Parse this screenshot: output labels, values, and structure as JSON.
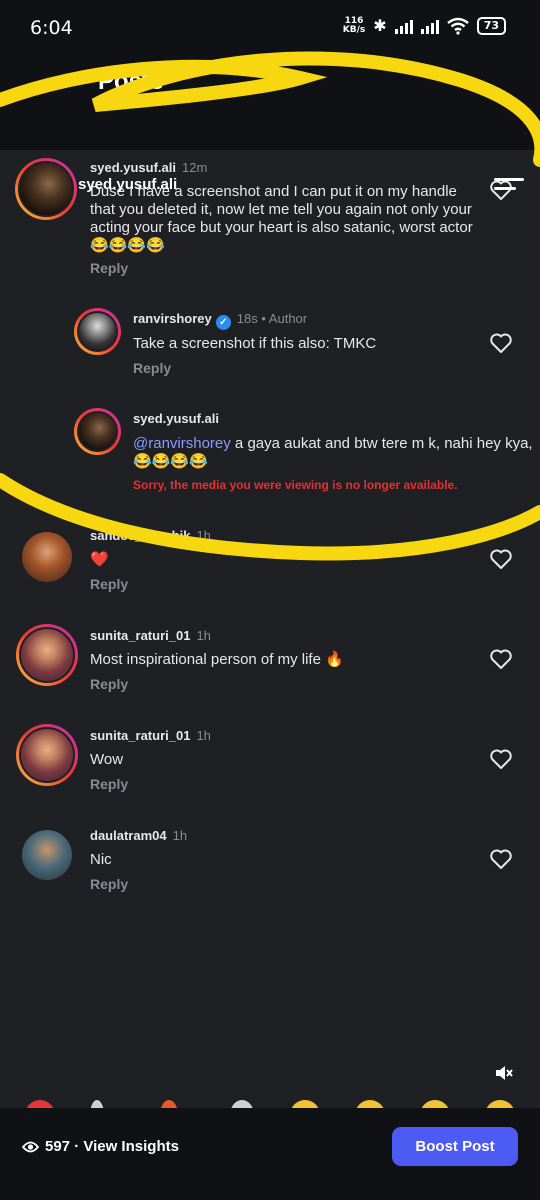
{
  "status_bar": {
    "time": "6:04",
    "speed_value": "116",
    "speed_unit": "KB/s",
    "battery": "73"
  },
  "header": {
    "title": "Posts"
  },
  "overlay": {
    "name": "syed.yusuf.ali"
  },
  "comments": [
    {
      "username": "syed.yusuf.ali",
      "time": "12m",
      "text": "Duse I have a screenshot and I can put it on my handle that you deleted it, now let me tell you again not only your acting your face but your heart is also satanic, worst actor 😂😂😂😂",
      "reply": "Reply"
    },
    {
      "username": "ranvirshorey",
      "time": "18s",
      "author": "• Author",
      "text": "Take a screenshot if this also: TMKC",
      "reply": "Reply"
    },
    {
      "username": "syed.yusuf.ali",
      "mention": "@ranvirshorey",
      "text": " a gaya aukat and btw tere m k, nahi hey kya, 😂😂😂😂",
      "error": "Sorry, the media you were viewing is no longer available."
    },
    {
      "username": "sahdev_kaushik",
      "time": "1h",
      "text": "❤️",
      "reply": "Reply"
    },
    {
      "username": "sunita_raturi_01",
      "time": "1h",
      "text": "Most inspirational person of my life 🔥",
      "reply": "Reply"
    },
    {
      "username": "sunita_raturi_01",
      "time": "1h",
      "text": "Wow",
      "reply": "Reply"
    },
    {
      "username": "daulatram04",
      "time": "1h",
      "text": "Nic",
      "reply": "Reply"
    }
  ],
  "bottom": {
    "insights": "597 · View Insights",
    "boost": "Boost Post"
  },
  "colors": {
    "background": "#1f2024",
    "bar": "#101114",
    "accent": "#4c5bf2",
    "scribble": "#f7d70f",
    "error": "#e53030",
    "mention": "#8a9bff"
  }
}
